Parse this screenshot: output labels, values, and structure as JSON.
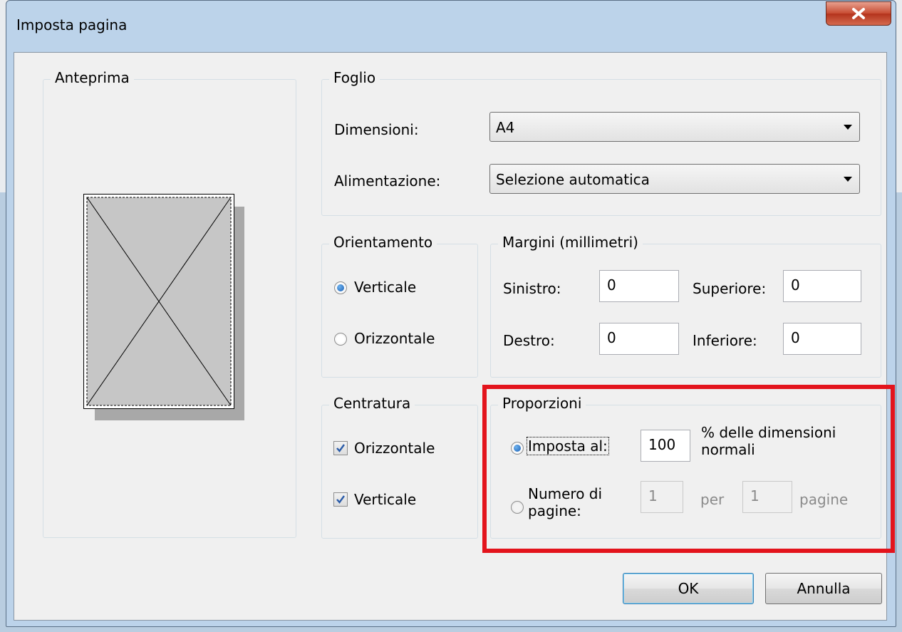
{
  "window": {
    "title": "Imposta pagina"
  },
  "preview": {
    "legend": "Anteprima"
  },
  "sheet": {
    "legend": "Foglio",
    "size_label": "Dimensioni:",
    "size_value": "A4",
    "source_label": "Alimentazione:",
    "source_value": "Selezione automatica"
  },
  "orientation": {
    "legend": "Orientamento",
    "portrait_label": "Verticale",
    "landscape_label": "Orizzontale"
  },
  "margins": {
    "legend": "Margini (millimetri)",
    "left_label": "Sinistro:",
    "left_value": "0",
    "top_label": "Superiore:",
    "top_value": "0",
    "right_label": "Destro:",
    "right_value": "0",
    "bottom_label": "Inferiore:",
    "bottom_value": "0"
  },
  "centering": {
    "legend": "Centratura",
    "horizontal_label": "Orizzontale",
    "vertical_label": "Verticale"
  },
  "scaling": {
    "legend": "Proporzioni",
    "adjust_label": "Imposta al:",
    "adjust_value": "100",
    "adjust_suffix_line1": "% delle dimensioni",
    "adjust_suffix_line2": "normali",
    "fit_label_line1": "Numero di",
    "fit_label_line2": "pagine:",
    "fit_wide_value": "1",
    "fit_per_label": "per",
    "fit_tall_value": "1",
    "fit_pages_label": "pagine"
  },
  "buttons": {
    "ok": "OK",
    "cancel": "Annulla"
  },
  "colors": {
    "highlight": "#e3141c",
    "titlebar": "#bcd3ea",
    "close": "#c74b32"
  }
}
